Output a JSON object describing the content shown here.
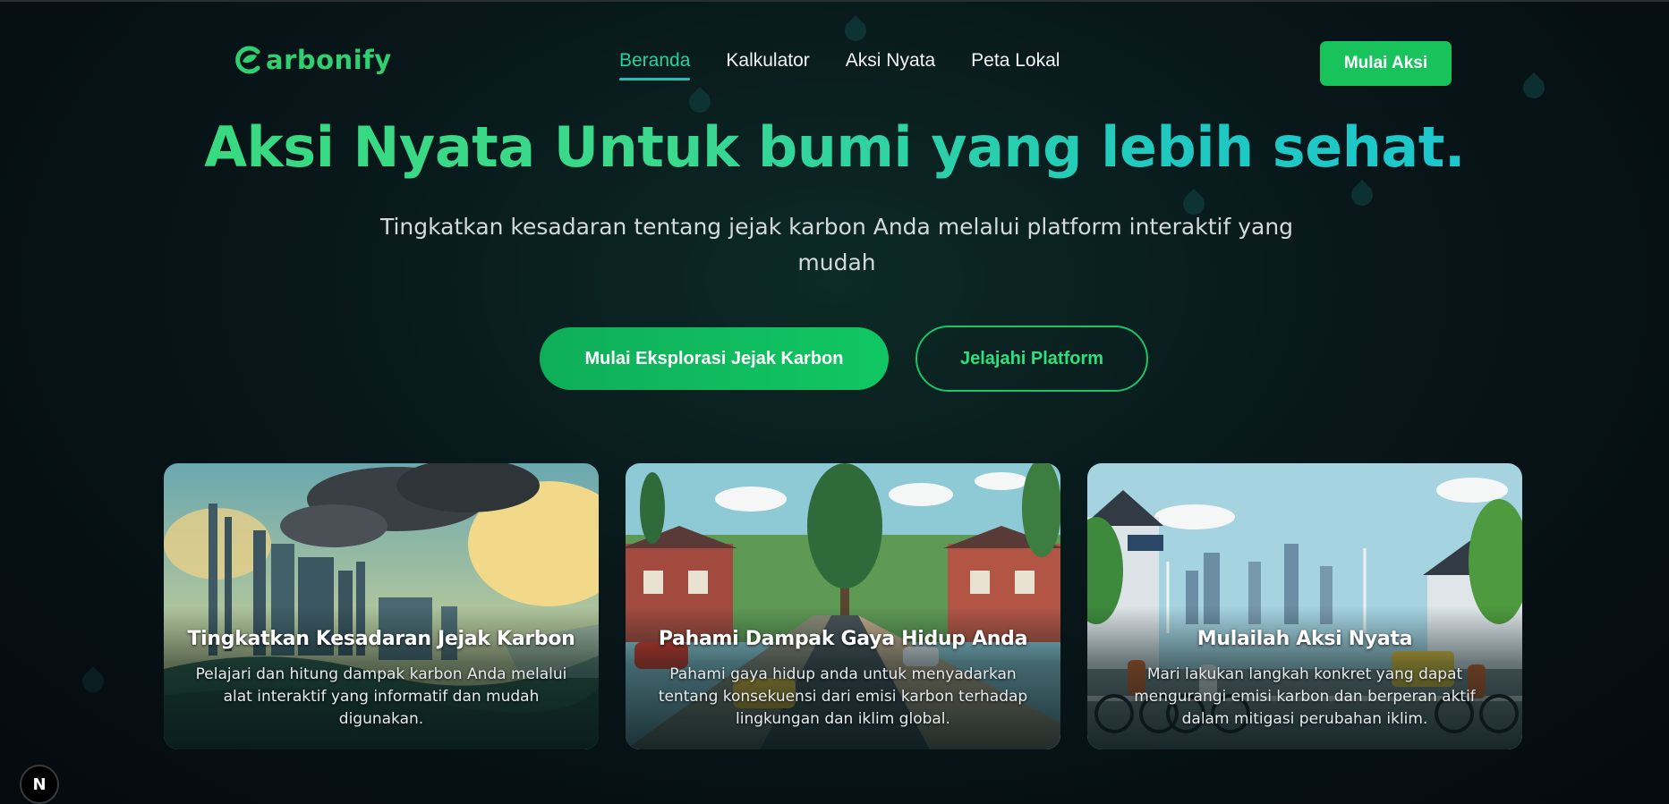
{
  "brand": {
    "name": "arbonify",
    "icon": "leaf-c-logo-icon",
    "color": "#2fcf72"
  },
  "nav": {
    "items": [
      {
        "label": "Beranda",
        "active": true
      },
      {
        "label": "Kalkulator",
        "active": false
      },
      {
        "label": "Aksi Nyata",
        "active": false
      },
      {
        "label": "Peta Lokal",
        "active": false
      }
    ],
    "cta_label": "Mulai Aksi"
  },
  "hero": {
    "title": "Aksi Nyata Untuk bumi yang lebih sehat.",
    "subtitle": "Tingkatkan kesadaran tentang jejak karbon Anda melalui platform interaktif yang mudah",
    "primary_button": "Mulai Eksplorasi Jejak Karbon",
    "secondary_button": "Jelajahi Platform"
  },
  "cards": [
    {
      "title": "Tingkatkan Kesadaran Jejak Karbon",
      "description": "Pelajari dan hitung dampak karbon Anda melalui alat interaktif yang informatif dan mudah digunakan.",
      "image": "factory-smoke-illustration"
    },
    {
      "title": "Pahami Dampak Gaya Hidup Anda",
      "description": "Pahami gaya hidup anda untuk menyadarkan tentang konsekuensi dari emisi karbon terhadap lingkungan dan iklim global.",
      "image": "suburban-street-illustration"
    },
    {
      "title": "Mulailah Aksi Nyata",
      "description": "Mari lakukan langkah konkret yang dapat mengurangi emisi karbon dan berperan aktif dalam mitigasi perubahan iklim.",
      "image": "cyclists-city-illustration"
    }
  ],
  "dev_badge": {
    "label": "N"
  },
  "colors": {
    "accent": "#19c35c",
    "teal": "#1fc0b6",
    "background": "#06110f"
  }
}
